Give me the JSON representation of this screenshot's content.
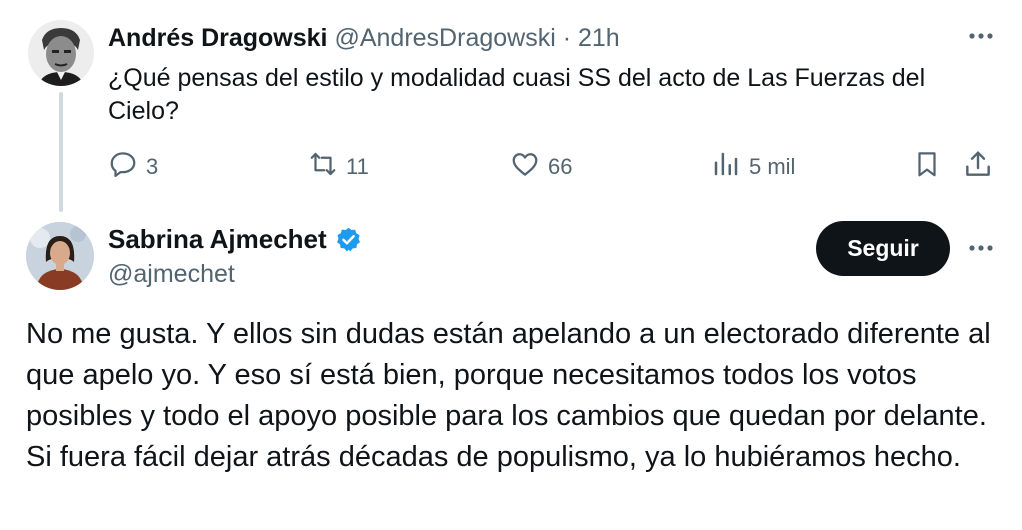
{
  "parent_tweet": {
    "author_name": "Andrés Dragowski",
    "author_handle": "@AndresDragowski",
    "separator": "·",
    "time": "21h",
    "text": "¿Qué pensas del estilo y modalidad cuasi SS del acto de Las Fuerzas del Cielo?",
    "actions": {
      "replies": "3",
      "retweets": "11",
      "likes": "66",
      "views": "5 mil"
    }
  },
  "reply_tweet": {
    "author_name": "Sabrina Ajmechet",
    "author_handle": "@ajmechet",
    "verified": true,
    "follow_label": "Seguir",
    "text": "No me gusta. Y ellos sin dudas están apelando a un electorado diferente al que apelo yo. Y eso sí está bien, porque necesitamos todos los votos posibles y todo el apoyo posible para los cambios que quedan por delante. Si fuera fácil dejar atrás décadas de populismo, ya lo hubiéramos hecho."
  },
  "colors": {
    "text_primary": "#0f1419",
    "text_secondary": "#536471",
    "verified_blue": "#1d9bf0",
    "thread_line": "#cfd9de",
    "button_bg": "#0f1419"
  },
  "icons": [
    "reply-icon",
    "retweet-icon",
    "like-icon",
    "views-icon",
    "bookmark-icon",
    "share-icon",
    "more-icon",
    "verified-icon"
  ]
}
